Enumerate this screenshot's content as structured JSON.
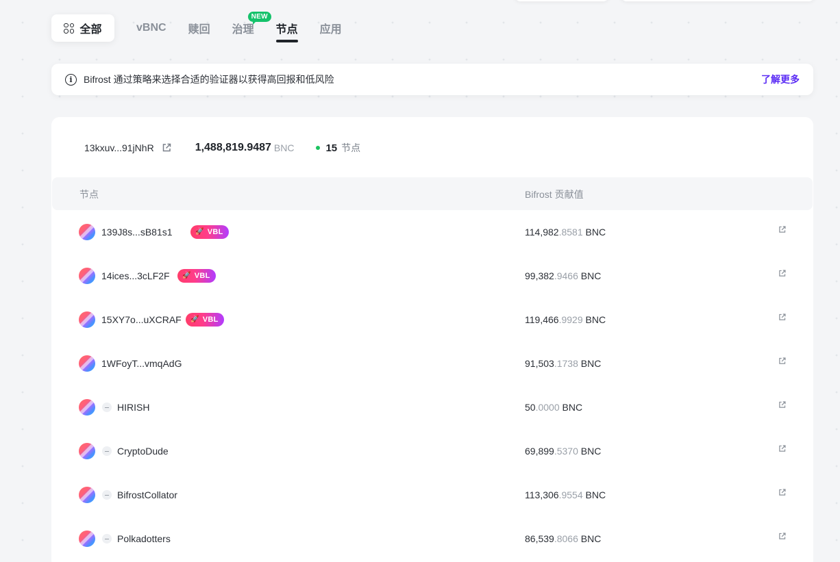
{
  "tabs": {
    "all_label": "全部",
    "items": [
      {
        "label": "vBNC",
        "active": false
      },
      {
        "label": "赎回",
        "active": false
      },
      {
        "label": "治理",
        "active": false,
        "badge": "NEW"
      },
      {
        "label": "节点",
        "active": true
      },
      {
        "label": "应用",
        "active": false
      }
    ]
  },
  "banner": {
    "text": "Bifrost 通过策略来选择合适的验证器以获得高回报和低风险",
    "link": "了解更多"
  },
  "summary": {
    "address": "13kxuv...91jNhR",
    "total": "1,488,819.9487",
    "unit": "BNC",
    "count": "15",
    "count_label": "节点"
  },
  "table": {
    "headers": [
      "节点",
      "Bifrost 贡献值"
    ],
    "rows": [
      {
        "name": "139J8s...sB81s1",
        "vbl": "VBL",
        "int": "114,982",
        "dec": ".8581",
        "unit": "BNC"
      },
      {
        "name": "14ices...3cLF2F",
        "vbl": "VBL",
        "int": "99,382",
        "dec": ".9466",
        "unit": "BNC"
      },
      {
        "name": "15XY7o...uXCRAF",
        "vbl": "VBL",
        "int": "119,466",
        "dec": ".9929",
        "unit": "BNC"
      },
      {
        "name": "1WFoyT...vmqAdG",
        "vbl": "",
        "int": "91,503",
        "dec": ".1738",
        "unit": "BNC"
      },
      {
        "name": "HIRISH",
        "vbl": "",
        "int": "50",
        "dec": ".0000",
        "unit": "BNC"
      },
      {
        "name": "CryptoDude",
        "vbl": "",
        "int": "69,899",
        "dec": ".5370",
        "unit": "BNC"
      },
      {
        "name": "BifrostCollator",
        "vbl": "",
        "int": "113,306",
        "dec": ".9554",
        "unit": "BNC"
      },
      {
        "name": "Polkadotters",
        "vbl": "",
        "int": "86,539",
        "dec": ".8066",
        "unit": "BNC"
      }
    ]
  },
  "colors": {
    "accent": "#5b2cf5",
    "status_dot": "#1bc35f",
    "new_badge": "#15c26b"
  }
}
